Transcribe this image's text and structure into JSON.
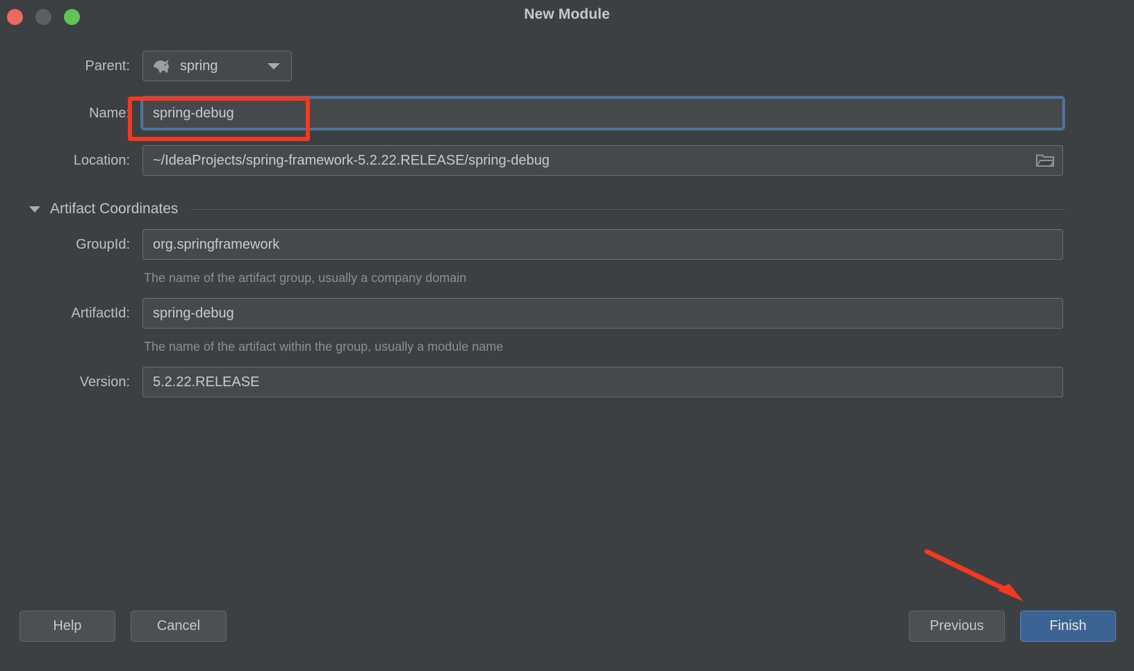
{
  "window": {
    "title": "New Module",
    "traffic_lights": [
      {
        "name": "close",
        "color": "#ed6a5e"
      },
      {
        "name": "minimize",
        "color": "#5b6064"
      },
      {
        "name": "maximize",
        "color": "#62c454"
      }
    ]
  },
  "form": {
    "parent": {
      "label": "Parent:",
      "value": "spring",
      "icon": "elephant-icon"
    },
    "name": {
      "label": "Name:",
      "value": "spring-debug",
      "focused": true
    },
    "location": {
      "label": "Location:",
      "value": "~/IdeaProjects/spring-framework-5.2.22.RELEASE/spring-debug",
      "browse_icon": "folder-icon"
    }
  },
  "artifact_section": {
    "title": "Artifact Coordinates",
    "expanded": true,
    "toggle_icon": "chevron-down-icon",
    "fields": [
      {
        "label": "GroupId:",
        "value": "org.springframework",
        "hint": "The name of the artifact group, usually a company domain"
      },
      {
        "label": "ArtifactId:",
        "value": "spring-debug",
        "hint": "The name of the artifact within the group, usually a module name"
      },
      {
        "label": "Version:",
        "value": "5.2.22.RELEASE",
        "hint": ""
      }
    ]
  },
  "buttons": {
    "help": "Help",
    "cancel": "Cancel",
    "previous": "Previous",
    "finish": "Finish"
  },
  "annotations": {
    "highlight_color": "#f4391f",
    "box_target": "name-input",
    "arrow_target": "finish-button"
  }
}
